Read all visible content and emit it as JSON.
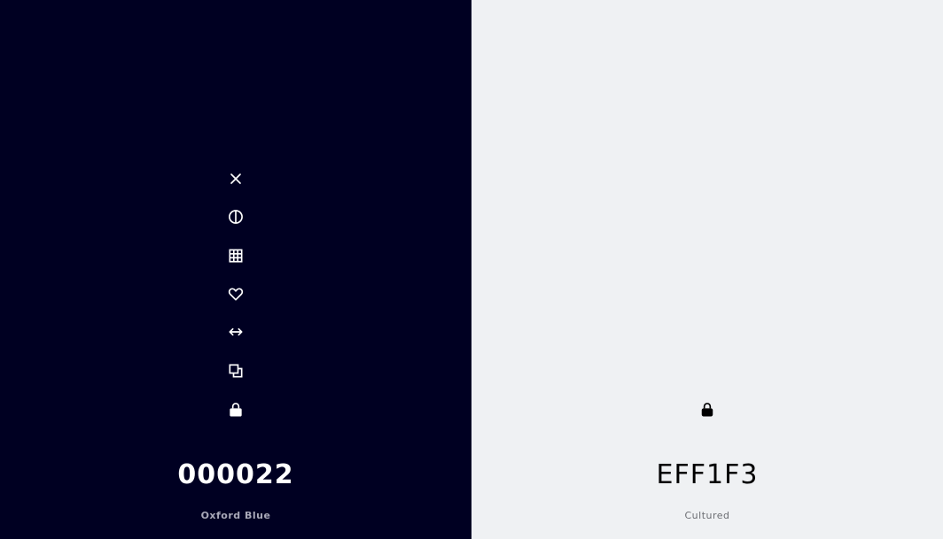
{
  "colors": [
    {
      "hex": "000022",
      "name": "Oxford Blue",
      "background": "#000022",
      "foreground": "#ffffff"
    },
    {
      "hex": "EFF1F3",
      "name": "Cultured",
      "background": "#EFF1F3",
      "foreground": "#000000"
    }
  ],
  "toolbar": {
    "icons": [
      "close-icon",
      "contrast-icon",
      "grid-icon",
      "heart-icon",
      "expand-width-icon",
      "copy-icon",
      "lock-icon"
    ]
  },
  "right_panel": {
    "icons": [
      "lock-icon"
    ]
  }
}
